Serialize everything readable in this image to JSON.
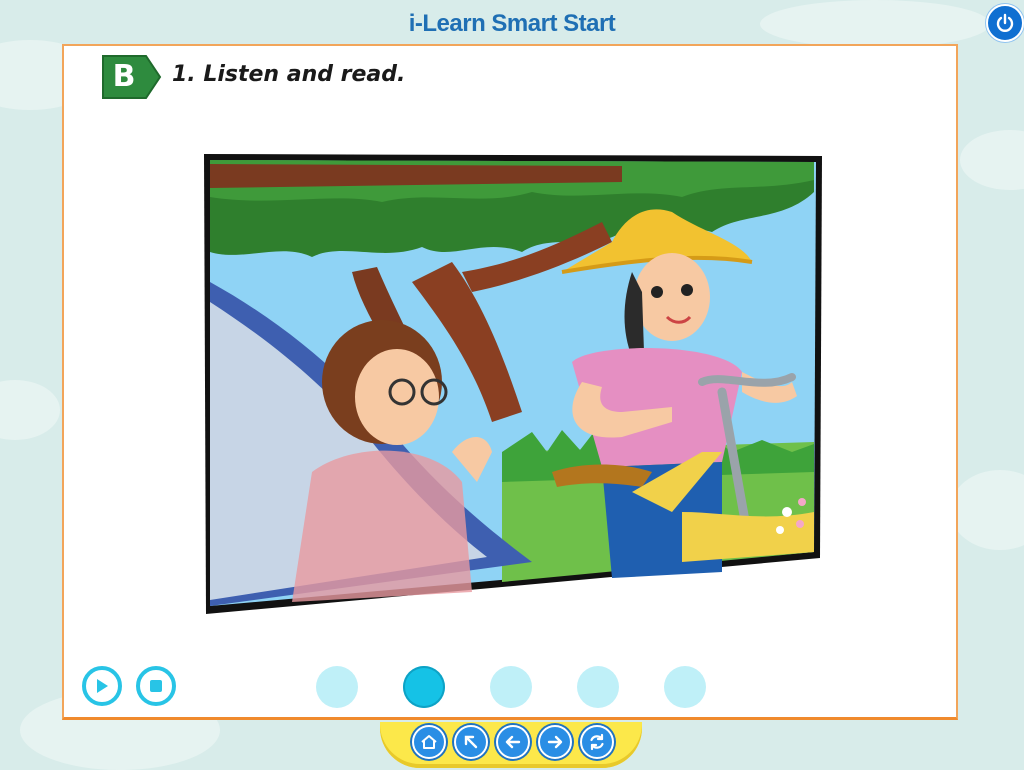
{
  "app": {
    "title": "i-Learn Smart Start"
  },
  "lesson": {
    "section_letter": "B",
    "instruction": "1. Listen and read."
  },
  "controls": {
    "play_icon": "play-icon",
    "stop_icon": "stop-icon"
  },
  "pager": {
    "total": 5,
    "active_index": 1
  },
  "nav": {
    "buttons": [
      "home-icon",
      "arrow-up-left-icon",
      "arrow-left-icon",
      "arrow-right-icon",
      "refresh-icon"
    ]
  },
  "colors": {
    "accent": "#28c4e6",
    "panel_border": "#f2a55a",
    "badge_green": "#2e8b3e",
    "nav_yellow": "#fce84a",
    "title_blue": "#1f6fb4"
  }
}
